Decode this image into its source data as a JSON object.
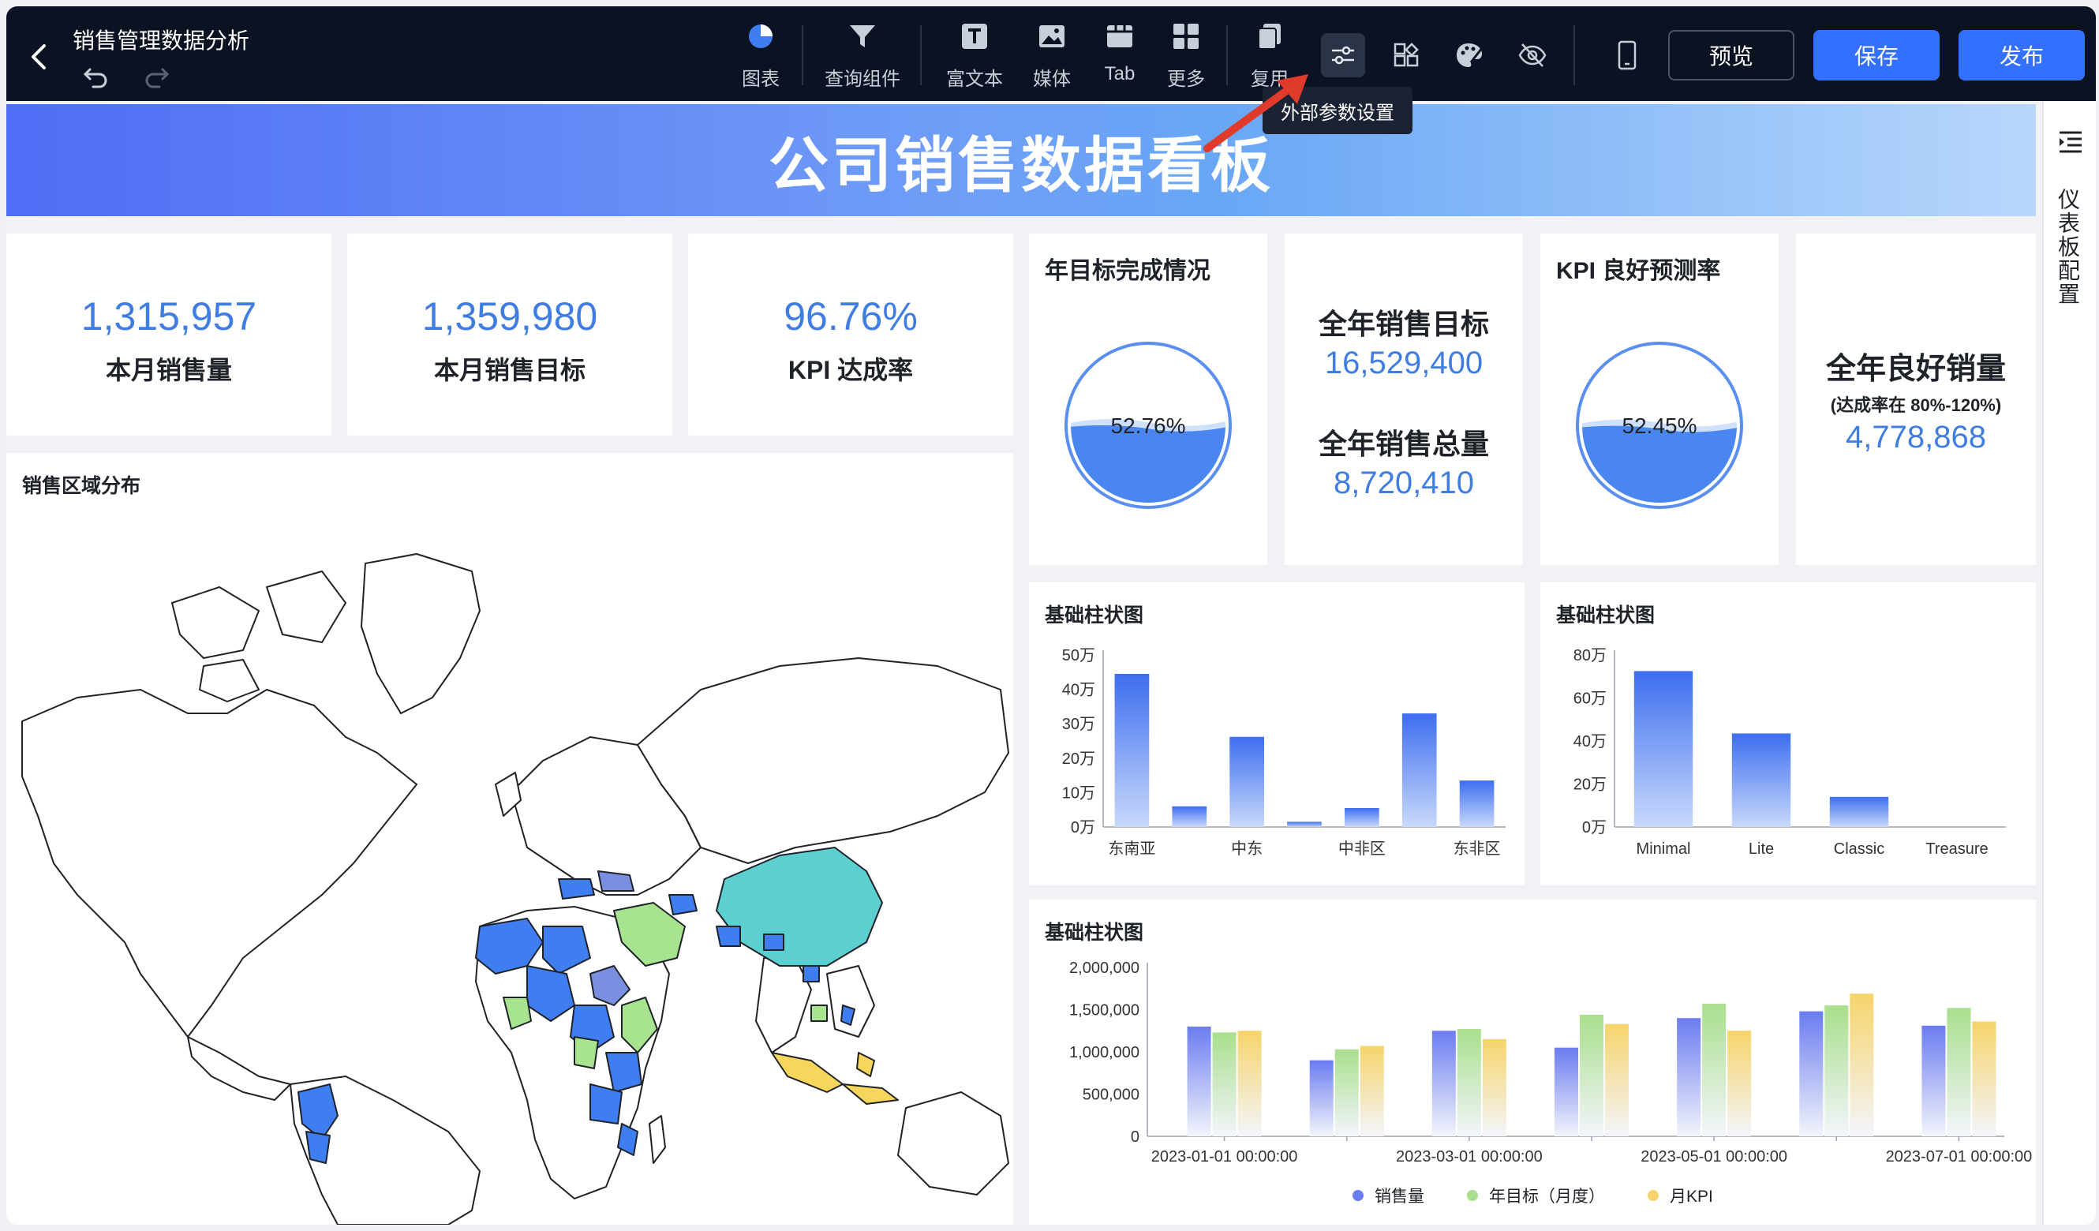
{
  "header": {
    "title": "销售管理数据分析",
    "tools": [
      {
        "label": "图表",
        "icon": "chart-pie-icon"
      },
      {
        "label": "查询组件",
        "icon": "filter-icon"
      },
      {
        "label": "富文本",
        "icon": "text-icon"
      },
      {
        "label": "媒体",
        "icon": "image-icon"
      },
      {
        "label": "Tab",
        "icon": "tab-icon"
      },
      {
        "label": "更多",
        "icon": "grid-icon"
      },
      {
        "label": "复用",
        "icon": "copy-icon"
      }
    ],
    "tooltip": "外部参数设置",
    "preview_label": "预览",
    "save_label": "保存",
    "publish_label": "发布"
  },
  "sidebar": {
    "label": "仪表板配置"
  },
  "banner": {
    "title": "公司销售数据看板"
  },
  "kpis": [
    {
      "value": "1,315,957",
      "label": "本月销售量"
    },
    {
      "value": "1,359,980",
      "label": "本月销售目标"
    },
    {
      "value": "96.76%",
      "label": "KPI 达成率"
    }
  ],
  "year_goal": {
    "title": "年目标完成情况",
    "percent_text": "52.76%",
    "fill": 0.5276
  },
  "annual": {
    "target_label": "全年销售目标",
    "target_value": "16,529,400",
    "total_label": "全年销售总量",
    "total_value": "8,720,410"
  },
  "kpi_good": {
    "title": "KPI 良好预测率",
    "percent_text": "52.45%",
    "fill": 0.5245
  },
  "good_sales": {
    "title": "全年良好销量",
    "subtitle": "(达成率在 80%-120%)",
    "value": "4,778,868"
  },
  "map": {
    "title": "销售区域分布",
    "colors": {
      "blue": "#3f7ef0",
      "teal": "#5ccfd0",
      "green": "#a8e38f",
      "yellow": "#f7d75b",
      "purple": "#7b8fe0"
    }
  },
  "chart_data": [
    {
      "type": "bar",
      "title": "基础柱状图",
      "categories": [
        "东南亚",
        "",
        "中东",
        "",
        "中非区",
        "",
        "东非区"
      ],
      "tick_labels": [
        "东南亚",
        "中东",
        "中非区",
        "东非区"
      ],
      "values": [
        445000,
        60000,
        262000,
        15000,
        55000,
        330000,
        135000
      ],
      "yticks": [
        "0万",
        "10万",
        "20万",
        "30万",
        "40万",
        "50万"
      ],
      "ylim": [
        0,
        500000
      ],
      "color": "#3d6ef0"
    },
    {
      "type": "bar",
      "title": "基础柱状图",
      "categories": [
        "Minimal",
        "Lite",
        "Classic",
        "Treasure"
      ],
      "values": [
        725000,
        435000,
        140000,
        0
      ],
      "yticks": [
        "0万",
        "20万",
        "40万",
        "60万",
        "80万"
      ],
      "ylim": [
        0,
        800000
      ],
      "color": "#3d6ef0"
    },
    {
      "type": "bar",
      "title": "基础柱状图",
      "x": [
        "2023-01-01 00:00:00",
        "2023-02-01 00:00:00",
        "2023-03-01 00:00:00",
        "2023-04-01 00:00:00",
        "2023-05-01 00:00:00",
        "2023-06-01 00:00:00",
        "2023-07-01 00:00:00"
      ],
      "tick_labels": [
        "2023-01-01 00:00:00",
        "2023-03-01 00:00:00",
        "2023-05-01 00:00:00",
        "2023-07-01 00:00:00"
      ],
      "yticks": [
        "0",
        "500,000",
        "1,000,000",
        "1,500,000",
        "2,000,000"
      ],
      "ylim": [
        0,
        2000000
      ],
      "series": [
        {
          "name": "销售量",
          "color": "#6b7cf0",
          "values": [
            1300000,
            900000,
            1250000,
            1050000,
            1400000,
            1480000,
            1310000
          ]
        },
        {
          "name": "年目标（月度）",
          "color": "#a9df8d",
          "values": [
            1230000,
            1030000,
            1270000,
            1440000,
            1570000,
            1550000,
            1520000
          ]
        },
        {
          "name": "月KPI",
          "color": "#f6d46b",
          "values": [
            1250000,
            1070000,
            1150000,
            1330000,
            1250000,
            1690000,
            1360000
          ]
        }
      ]
    }
  ]
}
